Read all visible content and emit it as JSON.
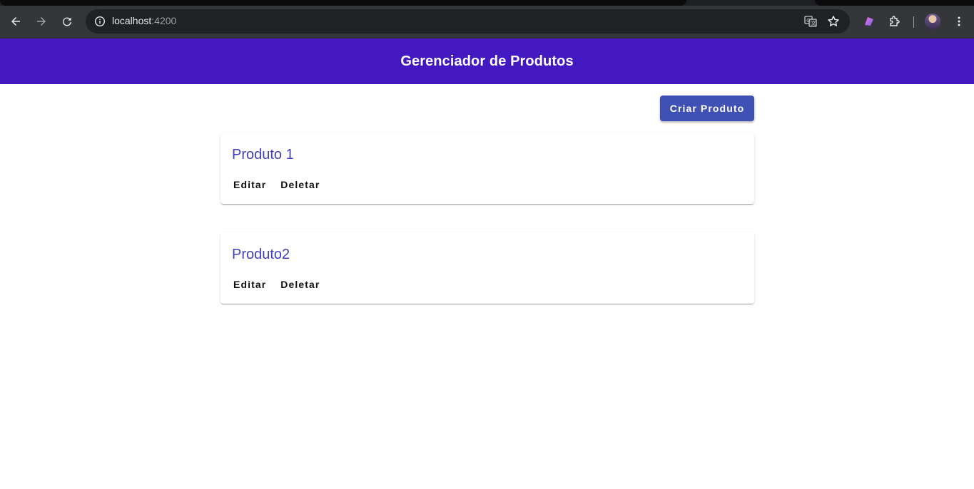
{
  "browser": {
    "url_host": "localhost",
    "url_port": ":4200",
    "icons": [
      "back-arrow-icon",
      "forward-arrow-icon",
      "reload-icon",
      "site-info-icon",
      "translate-icon",
      "bookmark-star-icon",
      "extension-icon",
      "puzzle-icon",
      "more-icon"
    ]
  },
  "app": {
    "title": "Gerenciador de Produtos",
    "create_label": "Criar Produto",
    "accent_color": "#4318c1",
    "button_color": "#3f51b5"
  },
  "products": [
    {
      "name": "Produto 1",
      "edit_label": "Editar",
      "delete_label": "Deletar"
    },
    {
      "name": "Produto2",
      "edit_label": "Editar",
      "delete_label": "Deletar"
    }
  ]
}
